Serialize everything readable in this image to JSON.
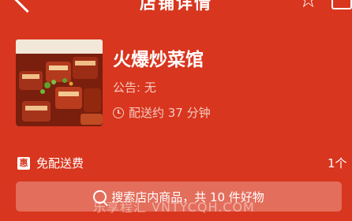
{
  "nav": {
    "title": "店铺详情"
  },
  "shop": {
    "name": "火爆炒菜馆",
    "notice": "公告: 无",
    "delivery": "配送约 37 分钟"
  },
  "promo": {
    "badge": "惠",
    "text": "免配送费",
    "count": "1个"
  },
  "search": {
    "text": "搜索店内商品，共 10 件好物"
  },
  "watermark": "乐享程汇 VNTYCQH.COM",
  "colors": {
    "background": "#d8361e",
    "text": "#ffffff"
  }
}
